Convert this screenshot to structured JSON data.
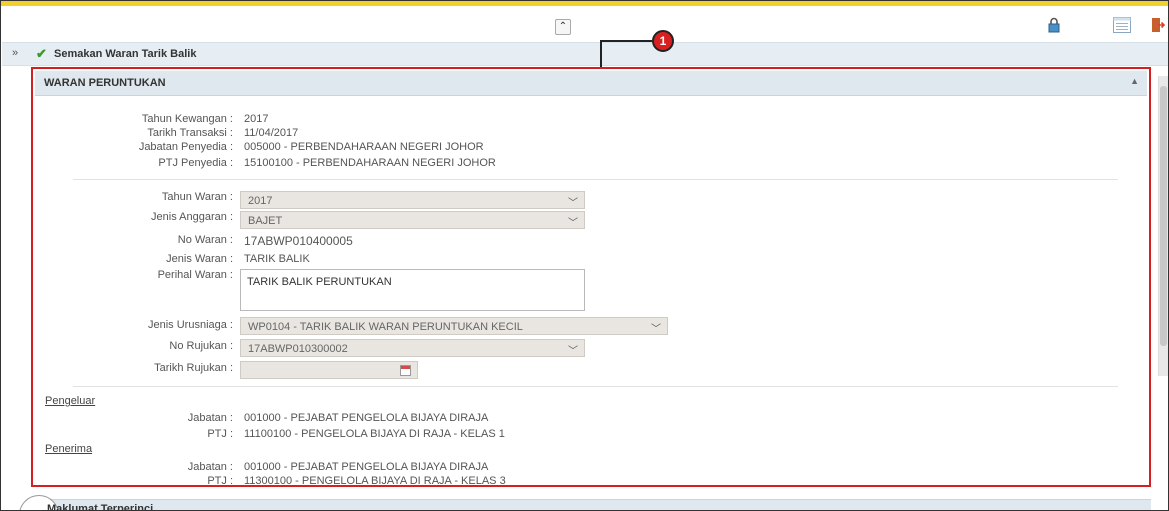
{
  "toolbar": {
    "collapse_glyph": "⌃"
  },
  "icons": {
    "lock": "lock-icon",
    "list": "list-icon",
    "exit": "exit-icon"
  },
  "callout_number": "1",
  "breadcrumb": {
    "arrow": "»",
    "title": "Semakan Waran Tarik Balik"
  },
  "panel": {
    "title": "WARAN PERUNTUKAN"
  },
  "summary": {
    "tahun_kewangan_label": "Tahun Kewangan :",
    "tahun_kewangan": "2017",
    "tarikh_transaksi_label": "Tarikh Transaksi :",
    "tarikh_transaksi": "11/04/2017",
    "jabatan_penyedia_label": "Jabatan Penyedia :",
    "jabatan_penyedia": "005000 - PERBENDAHARAAN NEGERI JOHOR",
    "ptj_penyedia_label": "PTJ Penyedia :",
    "ptj_penyedia": "15100100 - PERBENDAHARAAN NEGERI JOHOR"
  },
  "form": {
    "tahun_waran_label": "Tahun Waran :",
    "tahun_waran": "2017",
    "jenis_anggaran_label": "Jenis Anggaran :",
    "jenis_anggaran": "BAJET",
    "no_waran_label": "No Waran :",
    "no_waran": "17ABWP010400005",
    "jenis_waran_label": "Jenis Waran :",
    "jenis_waran": "TARIK BALIK",
    "perihal_waran_label": "Perihal Waran :",
    "perihal_waran": "TARIK BALIK PERUNTUKAN",
    "jenis_urusniaga_label": "Jenis Urusniaga :",
    "jenis_urusniaga": "WP0104 - TARIK BALIK WARAN PERUNTUKAN KECIL",
    "no_rujukan_label": "No Rujukan :",
    "no_rujukan": "17ABWP010300002",
    "tarikh_rujukan_label": "Tarikh Rujukan :",
    "tarikh_rujukan": ""
  },
  "pengeluar": {
    "heading": "Pengeluar",
    "jabatan_label": "Jabatan :",
    "jabatan": "001000 - PEJABAT PENGELOLA BIJAYA DIRAJA",
    "ptj_label": "PTJ :",
    "ptj": "11100100 - PENGELOLA BIJAYA DI RAJA - KELAS 1"
  },
  "penerima": {
    "heading": "Penerima",
    "jabatan_label": "Jabatan :",
    "jabatan": "001000 - PEJABAT PENGELOLA BIJAYA DIRAJA",
    "ptj_label": "PTJ :",
    "ptj": "11300100 - PENGELOLA BIJAYA DI RAJA - KELAS 3"
  },
  "bottom_panel": {
    "title": "Maklumat Terperinci"
  }
}
